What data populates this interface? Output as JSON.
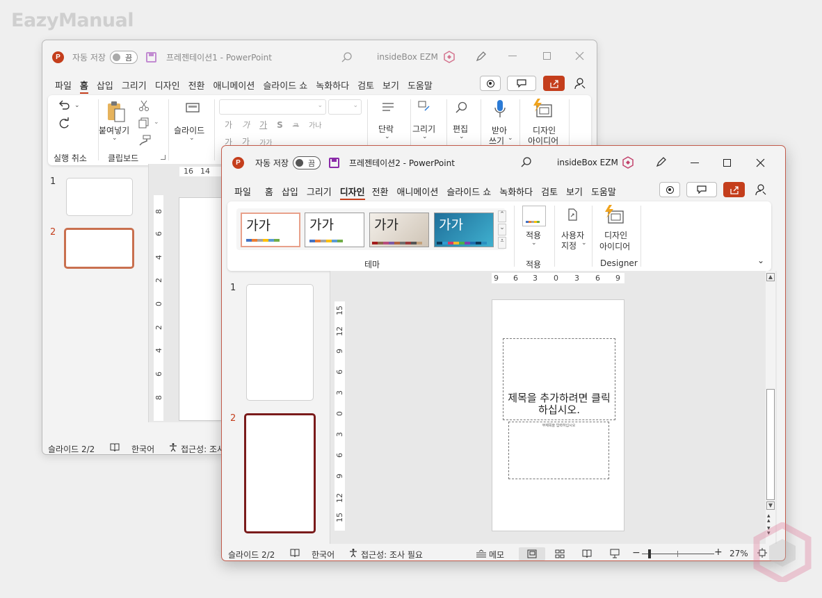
{
  "watermark": "EazyManual",
  "window1": {
    "autosave_label": "자동 저장",
    "autosave_state": "끔",
    "title": "프레젠테이션1 - PowerPoint",
    "user": "insideBox EZM",
    "menu": [
      "파일",
      "홈",
      "삽입",
      "그리기",
      "디자인",
      "전환",
      "애니메이션",
      "슬라이드 쇼",
      "녹화하다",
      "검토",
      "보기",
      "도움말"
    ],
    "active_tab": "홈",
    "ribbon": {
      "undo_group": "실행 취소",
      "paste_label": "붙여넣기",
      "clipboard_group": "클립보드",
      "slide_label": "슬라이드",
      "paragraph_label": "단락",
      "drawing_label": "그리기",
      "editing_label": "편집",
      "dictate_label_1": "받아",
      "dictate_label_2": "쓰기",
      "designer_label_1": "디자인",
      "designer_label_2": "아이디어",
      "font_row_1": [
        "가",
        "가",
        "가",
        "S",
        "ㅋ",
        "가나"
      ],
      "font_row_2": [
        "가",
        "가",
        "가가"
      ]
    },
    "slides": [
      "1",
      "2"
    ],
    "ruler_top": [
      "16",
      "14"
    ],
    "ruler_left": [
      "8",
      "6",
      "4",
      "2",
      "0",
      "2",
      "4",
      "6",
      "8"
    ],
    "status": {
      "slide": "슬라이드 2/2",
      "language": "한국어",
      "accessibility": "접근성: 조사"
    }
  },
  "window2": {
    "autosave_label": "자동 저장",
    "autosave_state": "끔",
    "title": "프레젠테이션2 - PowerPoint",
    "user": "insideBox EZM",
    "menu": [
      "파일",
      "홈",
      "삽입",
      "그리기",
      "디자인",
      "전환",
      "애니메이션",
      "슬라이드 쇼",
      "녹화하다",
      "검토",
      "보기",
      "도움말"
    ],
    "active_tab": "디자인",
    "ribbon": {
      "theme_sample": "가가",
      "theme_group": "테마",
      "variant_label": "적용",
      "variant_group": "적용",
      "customize_label_1": "사용자",
      "customize_label_2": "지정",
      "designer_label_1": "디자인",
      "designer_label_2": "아이디어",
      "designer_group": "Designer"
    },
    "slides": [
      "1",
      "2"
    ],
    "ruler_top": [
      "9",
      "6",
      "3",
      "0",
      "3",
      "6",
      "9"
    ],
    "ruler_left": [
      "15",
      "12",
      "9",
      "6",
      "3",
      "0",
      "3",
      "6",
      "9",
      "12",
      "15"
    ],
    "slide_title_placeholder": "제목을 추가하려면 클릭하십시오.",
    "slide_subtitle_placeholder": "부제목을 입력하십시오",
    "status": {
      "slide": "슬라이드 2/2",
      "language": "한국어",
      "accessibility": "접근성: 조사 필요",
      "notes": "메모",
      "zoom": "27%"
    }
  },
  "colors": {
    "accent": "#c43e1c",
    "selected_slide": "#7a1b1b"
  }
}
